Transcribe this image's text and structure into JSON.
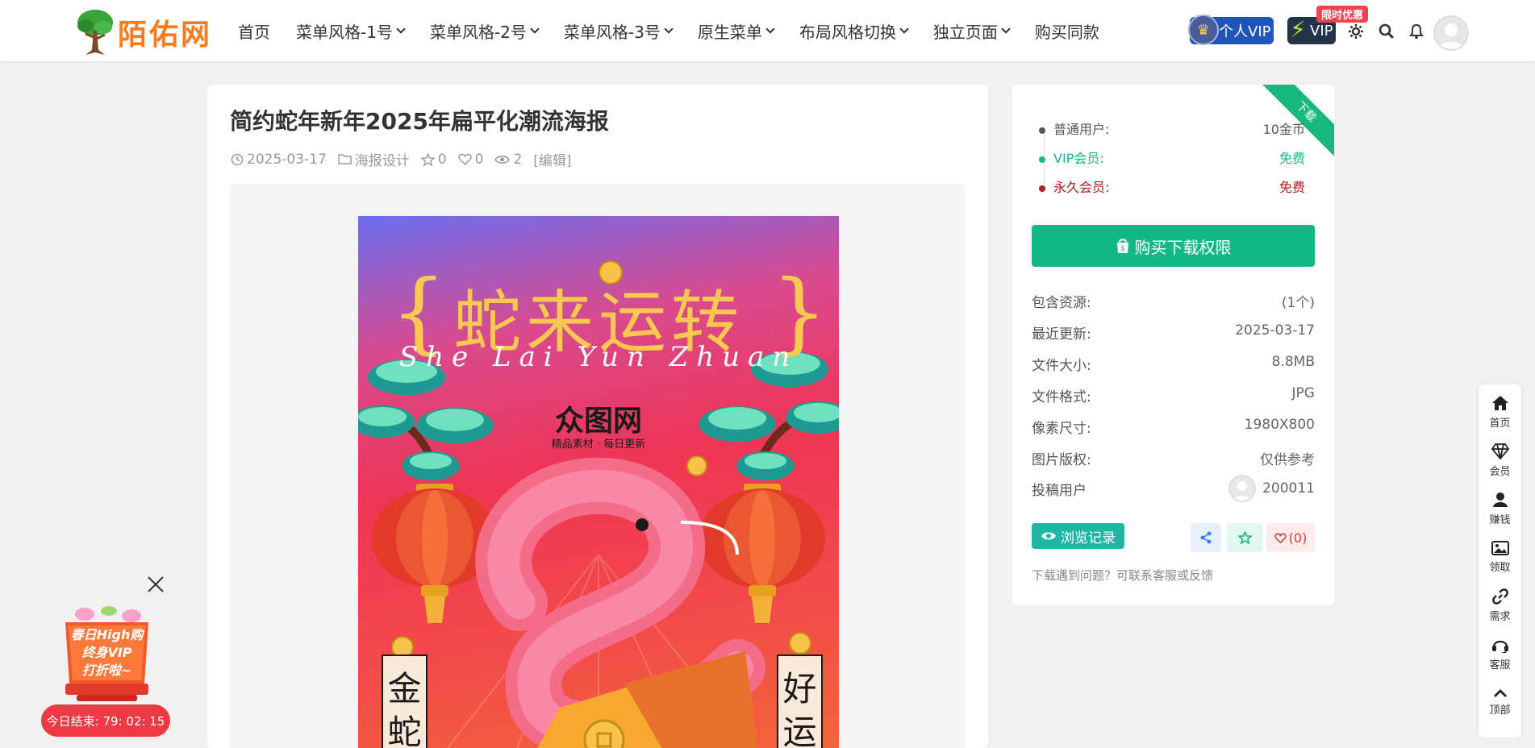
{
  "header": {
    "logo_text": "陌佑网",
    "nav": [
      {
        "label": "首页",
        "has_caret": false
      },
      {
        "label": "菜单风格-1号",
        "has_caret": true
      },
      {
        "label": "菜单风格-2号",
        "has_caret": true
      },
      {
        "label": "菜单风格-3号",
        "has_caret": true
      },
      {
        "label": "原生菜单",
        "has_caret": true
      },
      {
        "label": "布局风格切换",
        "has_caret": true
      },
      {
        "label": "独立页面",
        "has_caret": true
      },
      {
        "label": "购买同款",
        "has_caret": false
      }
    ],
    "vip_personal_label": "个人VIP",
    "vip_label": "VIP",
    "limited_offer_tag": "限时优惠",
    "icons": [
      "theme-toggle-icon",
      "search-icon",
      "bell-icon",
      "user-avatar"
    ]
  },
  "post": {
    "title": "简约蛇年新年2025年扁平化潮流海报",
    "date": "2025-03-17",
    "category": "海报设计",
    "stars": "0",
    "likes": "0",
    "views": "2",
    "edit_label": "[编辑]",
    "poster": {
      "headline": "蛇来运转",
      "script_text": "She Lai Yun Zhuan",
      "watermark_logo": "众图网",
      "watermark_sub": "精品素材 · 每日更新",
      "left_banner": "金蛇",
      "right_banner": "好运"
    }
  },
  "download": {
    "ribbon": "下载",
    "prices": [
      {
        "label": "普通用户:",
        "value": "10金币",
        "color": "#555555",
        "dot": "#555555"
      },
      {
        "label": "VIP会员:",
        "value": "免费",
        "color": "#12b886",
        "dot": "#12b886"
      },
      {
        "label": "永久会员:",
        "value": "免费",
        "color": "#b31d1d",
        "dot": "#b31d1d"
      }
    ],
    "buy_label": "购买下载权限",
    "info": [
      {
        "label": "包含资源:",
        "value": "(1个)"
      },
      {
        "label": "最近更新:",
        "value": "2025-03-17"
      },
      {
        "label": "文件大小:",
        "value": "8.8MB"
      },
      {
        "label": "文件格式:",
        "value": "JPG"
      },
      {
        "label": "像素尺寸:",
        "value": "1980X800"
      },
      {
        "label": "图片版权:",
        "value": "仅供参考"
      }
    ],
    "uploader_label": "投稿用户",
    "uploader_name": "200011",
    "history_label": "浏览记录",
    "like_count": "(0)",
    "help": "下载遇到问题？可联系客服或反馈"
  },
  "float_bar": [
    {
      "label": "首页",
      "icon": "home-icon"
    },
    {
      "label": "会员",
      "icon": "diamond-icon"
    },
    {
      "label": "赚钱",
      "icon": "user-icon"
    },
    {
      "label": "领取",
      "icon": "image-icon"
    },
    {
      "label": "需求",
      "icon": "link-icon"
    },
    {
      "label": "客服",
      "icon": "headset-icon"
    },
    {
      "label": "顶部",
      "icon": "chevron-up-icon"
    }
  ],
  "promo": {
    "art_lines": [
      "春日High购",
      "终身VIP",
      "打折啦~"
    ],
    "timer": "今日结束: 79: 02: 15"
  },
  "colors": {
    "accent_green": "#12b886",
    "teal": "#1fb6a3",
    "vip_blue": "#1f54b8",
    "promo_red": "#ee3a45"
  }
}
